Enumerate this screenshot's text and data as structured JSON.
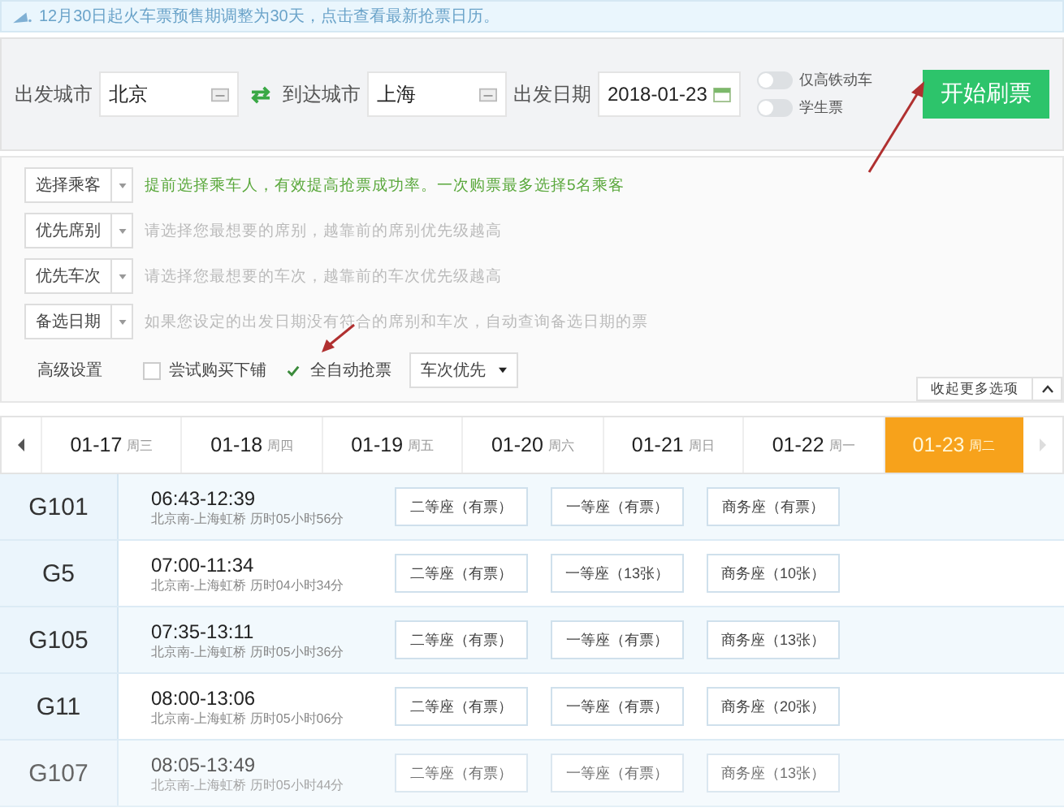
{
  "notice": {
    "text": "12月30日起火车票预售期调整为30天，点击查看最新抢票日历。"
  },
  "search": {
    "fields": [
      {
        "label": "出发城市",
        "value": "北京",
        "kind": "city"
      },
      {
        "label": "到达城市",
        "value": "上海",
        "kind": "city"
      },
      {
        "label": "出发日期",
        "value": "2018-01-23",
        "kind": "date"
      }
    ],
    "toggles": [
      {
        "label": "仅高铁动车",
        "on": false
      },
      {
        "label": "学生票",
        "on": false
      }
    ],
    "start_button": "开始刷票"
  },
  "options": [
    {
      "label": "选择乘客",
      "hint": "提前选择乘车人，有效提高抢票成功率。一次购票最多选择5名乘客",
      "emphasis": true
    },
    {
      "label": "优先席别",
      "hint": "请选择您最想要的席别，越靠前的席别优先级越高",
      "emphasis": false
    },
    {
      "label": "优先车次",
      "hint": "请选择您最想要的车次，越靠前的车次优先级越高",
      "emphasis": false
    },
    {
      "label": "备选日期",
      "hint": "如果您设定的出发日期没有符合的席别和车次，自动查询备选日期的票",
      "emphasis": false
    }
  ],
  "advanced": {
    "label": "高级设置",
    "checkboxes": [
      {
        "label": "尝试购买下铺",
        "checked": false
      },
      {
        "label": "全自动抢票",
        "checked": true
      }
    ],
    "priority": "车次优先",
    "collapse": "收起更多选项"
  },
  "date_tabs": [
    {
      "date": "01-17",
      "weekday": "周三",
      "selected": false
    },
    {
      "date": "01-18",
      "weekday": "周四",
      "selected": false
    },
    {
      "date": "01-19",
      "weekday": "周五",
      "selected": false
    },
    {
      "date": "01-20",
      "weekday": "周六",
      "selected": false
    },
    {
      "date": "01-21",
      "weekday": "周日",
      "selected": false
    },
    {
      "date": "01-22",
      "weekday": "周一",
      "selected": false
    },
    {
      "date": "01-23",
      "weekday": "周二",
      "selected": true
    }
  ],
  "trains": [
    {
      "code": "G101",
      "time": "06:43-12:39",
      "route": "北京南-上海虹桥 历时05小时56分",
      "seats": [
        "二等座（有票）",
        "一等座（有票）",
        "商务座（有票）"
      ],
      "faded": false
    },
    {
      "code": "G5",
      "time": "07:00-11:34",
      "route": "北京南-上海虹桥 历时04小时34分",
      "seats": [
        "二等座（有票）",
        "一等座（13张）",
        "商务座（10张）"
      ],
      "faded": false
    },
    {
      "code": "G105",
      "time": "07:35-13:11",
      "route": "北京南-上海虹桥 历时05小时36分",
      "seats": [
        "二等座（有票）",
        "一等座（有票）",
        "商务座（13张）"
      ],
      "faded": false
    },
    {
      "code": "G11",
      "time": "08:00-13:06",
      "route": "北京南-上海虹桥 历时05小时06分",
      "seats": [
        "二等座（有票）",
        "一等座（有票）",
        "商务座（20张）"
      ],
      "faded": false
    },
    {
      "code": "G107",
      "time": "08:05-13:49",
      "route": "北京南-上海虹桥 历时05小时44分",
      "seats": [
        "二等座（有票）",
        "一等座（有票）",
        "商务座（13张）"
      ],
      "faded": true
    }
  ]
}
